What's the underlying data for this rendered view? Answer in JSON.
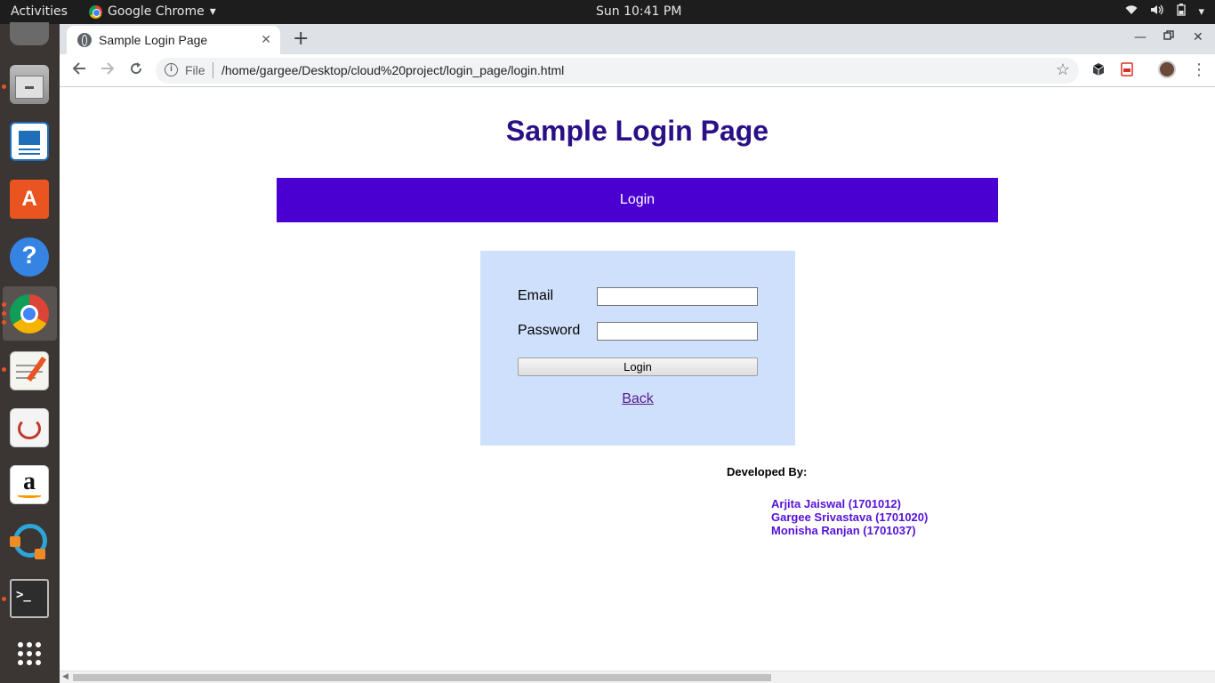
{
  "system": {
    "activities": "Activities",
    "app_name": "Google Chrome",
    "clock": "Sun 10:41 PM"
  },
  "browser": {
    "tab_title": "Sample Login Page",
    "new_tab": "+",
    "omnibox_scheme": "File",
    "url": "/home/gargee/Desktop/cloud%20project/login_page/login.html"
  },
  "page": {
    "title": "Sample Login Page",
    "banner": "Login",
    "form": {
      "email_label": "Email",
      "email_value": "",
      "password_label": "Password",
      "password_value": "",
      "login_button": "Login",
      "back_link": "Back"
    },
    "developers": {
      "heading": "Developed By:",
      "names": [
        "Arjita Jaiswal (1701012)",
        "Gargee Srivastava (1701020)",
        "Monisha Ranjan (1701037)"
      ]
    }
  },
  "colors": {
    "title": "#2a0f86",
    "banner_bg": "#4b00d2",
    "form_bg": "#cfe0fc",
    "developer_names": "#5512d8"
  },
  "dock_icons": [
    "sound-juicer-icon",
    "files-icon",
    "libreoffice-impress-icon",
    "software-store-icon",
    "help-icon",
    "chrome-icon",
    "text-editor-icon",
    "document-viewer-icon",
    "amazon-icon",
    "share-icon",
    "terminal-icon",
    "show-apps-icon"
  ]
}
